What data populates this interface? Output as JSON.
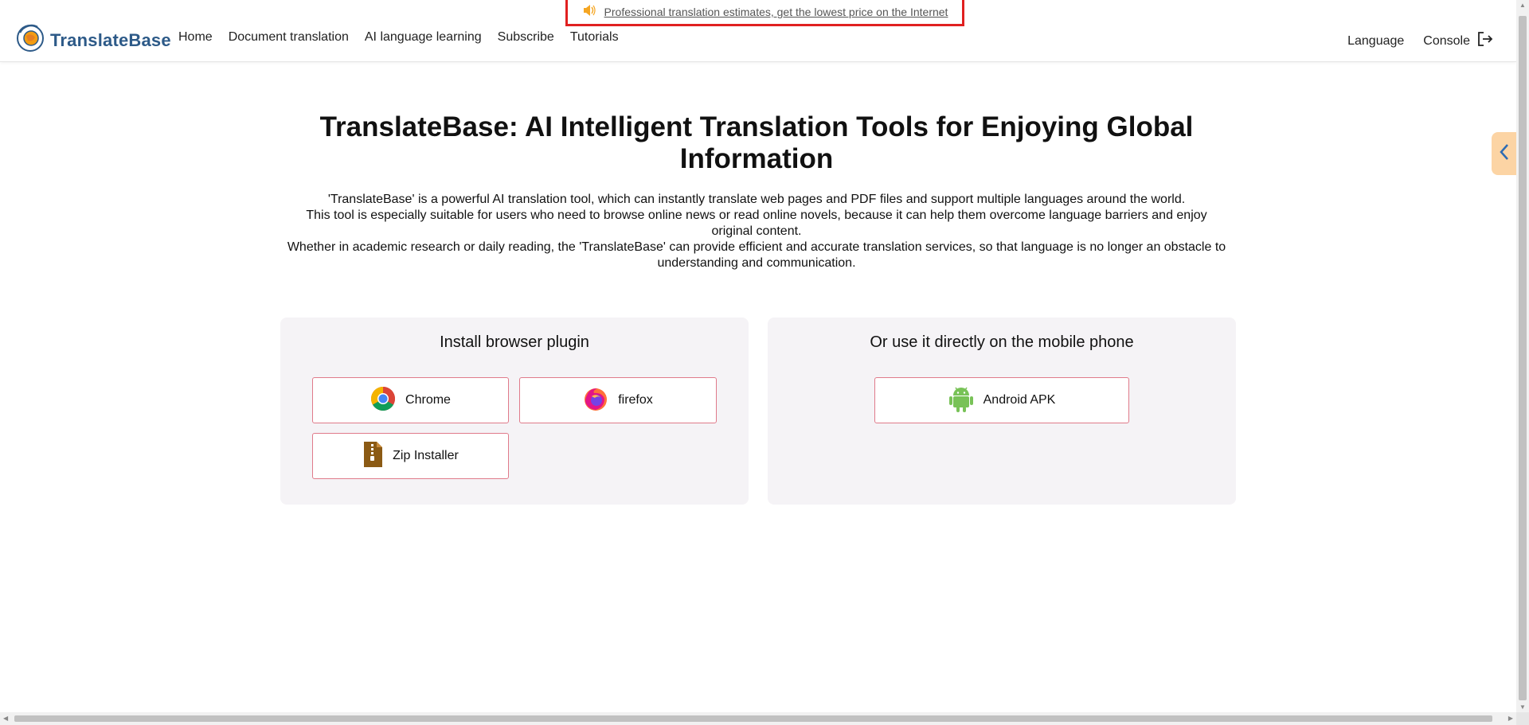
{
  "announcement": {
    "text": "Professional translation estimates, get the lowest price on the Internet"
  },
  "header": {
    "logo_text": "TranslateBase",
    "nav": [
      "Home",
      "Document translation",
      "AI language learning",
      "Subscribe",
      "Tutorials"
    ],
    "language_label": "Language",
    "console_label": "Console"
  },
  "hero": {
    "title": "TranslateBase: AI Intelligent Translation Tools for Enjoying Global Information",
    "desc_line1": "'TranslateBase' is a powerful AI translation tool, which can instantly translate web pages and PDF files and support multiple languages around the world.",
    "desc_line2": "This tool is especially suitable for users who need to browse online news or read online novels, because it can help them overcome language barriers and enjoy original content.",
    "desc_line3": "Whether in academic research or daily reading, the 'TranslateBase' can provide efficient and accurate translation services, so that language is no longer an obstacle to understanding and communication."
  },
  "plugin_card": {
    "title": "Install browser plugin",
    "chrome": "Chrome",
    "firefox": "firefox",
    "zip": "Zip Installer"
  },
  "mobile_card": {
    "title": "Or use it directly on the mobile phone",
    "android": "Android APK"
  },
  "colors": {
    "accent_border": "#e07a8a",
    "logo_blue": "#2d5a88",
    "side_tab": "#fcd4a4",
    "card_bg": "#f5f3f6"
  },
  "icons": [
    "speaker-icon",
    "logo-icon",
    "logout-icon",
    "chrome-icon",
    "firefox-icon",
    "zip-icon",
    "android-icon",
    "chevron-left-icon"
  ]
}
